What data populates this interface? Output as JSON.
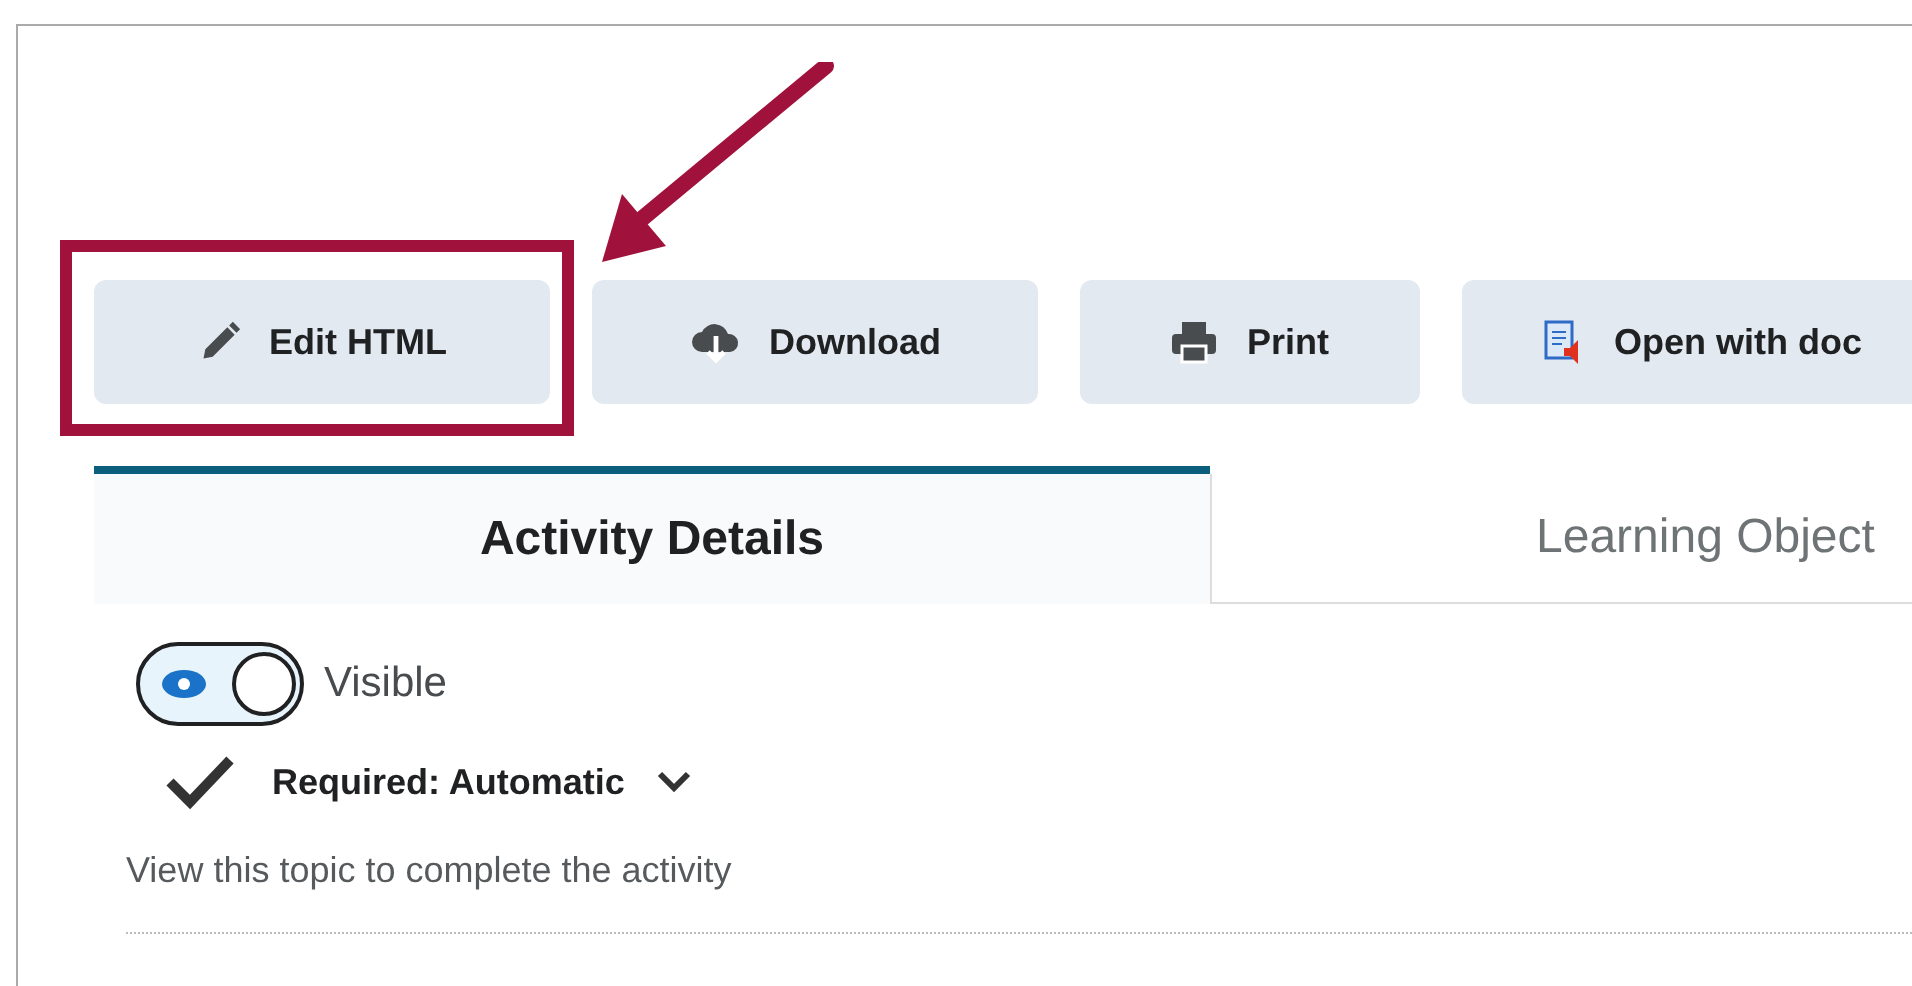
{
  "toolbar": {
    "buttons": [
      {
        "label": "Edit HTML",
        "kind": "pencil",
        "highlighted": true
      },
      {
        "label": "Download",
        "kind": "download",
        "highlighted": false
      },
      {
        "label": "Print",
        "kind": "print",
        "highlighted": false
      },
      {
        "label": "Open with doc",
        "kind": "reader",
        "highlighted": false
      }
    ]
  },
  "tabs": [
    {
      "label": "Activity Details",
      "selected": true
    },
    {
      "label": "Learning Object",
      "selected": false
    }
  ],
  "visibility": {
    "on": true,
    "label": "Visible"
  },
  "completion": {
    "label": "Required: Automatic",
    "description": "View this topic to complete the activity"
  }
}
